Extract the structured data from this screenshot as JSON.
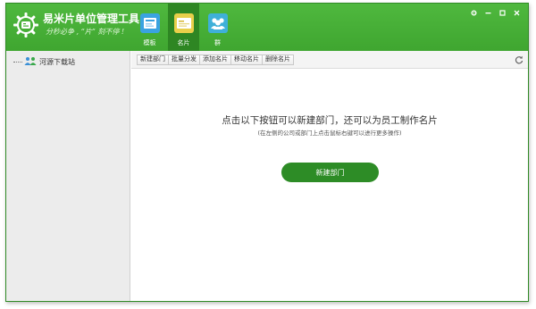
{
  "app": {
    "title": "易米片单位管理工具",
    "slogan": "分秒必争 , “片” 刻不停 !"
  },
  "nav": {
    "tabs": [
      {
        "label": "模板",
        "icon": "template-icon",
        "active": false
      },
      {
        "label": "名片",
        "icon": "card-icon",
        "active": true
      },
      {
        "label": "群",
        "icon": "group-icon",
        "active": false
      }
    ]
  },
  "window_controls": [
    "settings-icon",
    "minimize-icon",
    "maximize-icon",
    "close-icon"
  ],
  "sidebar": {
    "tree": [
      {
        "label": "河源下载站",
        "icon": "organization-icon"
      }
    ]
  },
  "toolbar": {
    "buttons": [
      "新建部门",
      "批量分发",
      "添加名片",
      "移动名片",
      "删除名片"
    ]
  },
  "main": {
    "title": "点击以下按钮可以新建部门，还可以为员工制作名片",
    "hint": "(在左侧的公司或部门上点击鼠标右键可以进行更多操作)",
    "button": "新建部门"
  },
  "colors": {
    "header_green": "#44ad34",
    "active_tab": "#2e8623",
    "primary_button": "#2d8c26"
  }
}
